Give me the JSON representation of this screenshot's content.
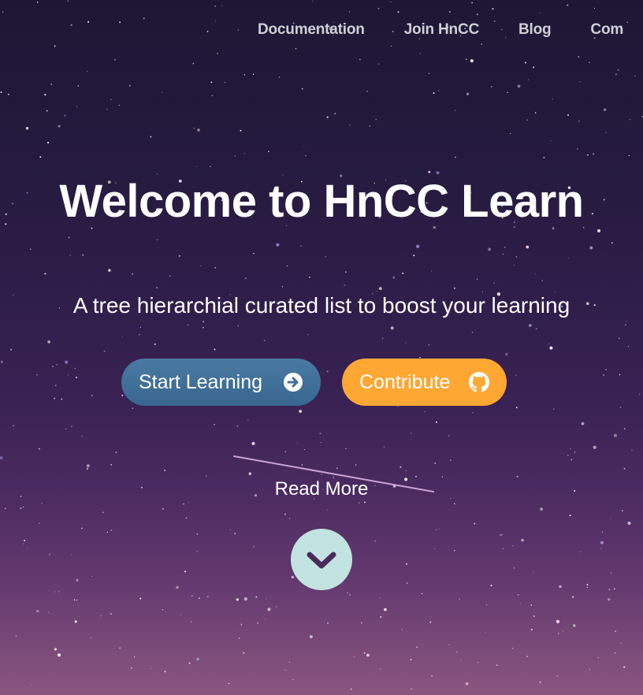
{
  "nav": {
    "links": [
      {
        "label": "Documentation"
      },
      {
        "label": "Join HnCC"
      },
      {
        "label": "Blog"
      },
      {
        "label": "Com"
      }
    ]
  },
  "hero": {
    "title": "Welcome to HnCC Learn",
    "subtitle": "A tree hierarchial curated list to boost your learning"
  },
  "buttons": {
    "start": {
      "label": "Start Learning",
      "icon": "arrow-right-circle-icon",
      "color": "#3f6e96"
    },
    "contribute": {
      "label": "Contribute",
      "icon": "github-icon",
      "color": "#ffa733"
    }
  },
  "read_more": {
    "label": "Read More",
    "icon": "chevron-down-icon",
    "circle_color": "#c3e3e0",
    "chevron_color": "#4a2a5a"
  },
  "theme": {
    "background_top": "#1d1734",
    "background_bottom": "#8a5680"
  }
}
